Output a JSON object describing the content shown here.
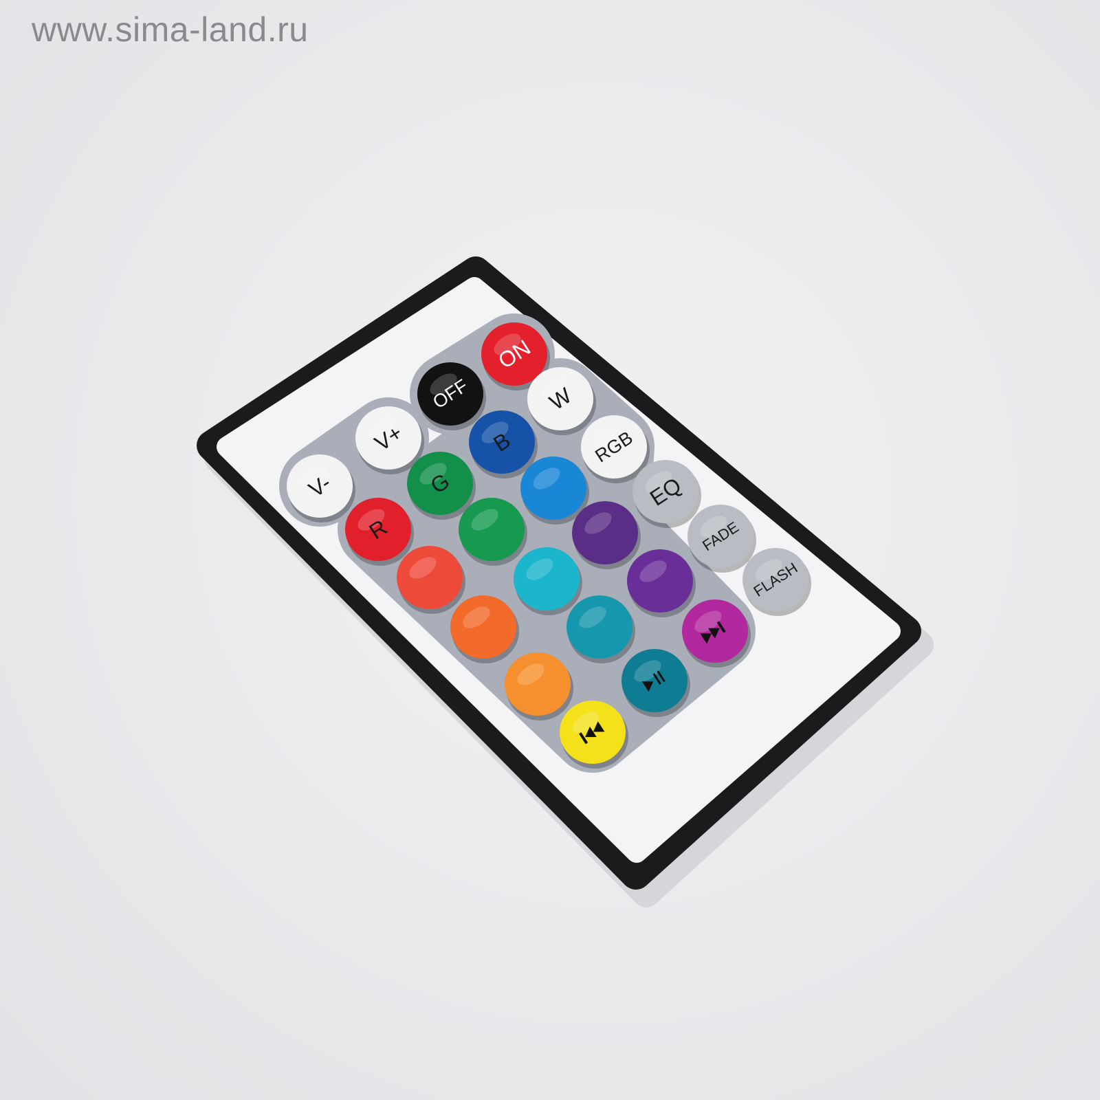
{
  "watermark": "www.sima-land.ru",
  "remote": {
    "body_color": "#1b1b1d",
    "face_color": "#f4f4f6",
    "panel_color": "#a9aeb8",
    "rows": [
      [
        {
          "label": "V-",
          "color": "#f3f3f3",
          "text": "#1a1a1a"
        },
        {
          "label": "V+",
          "color": "#f3f3f3",
          "text": "#1a1a1a"
        },
        {
          "label": "OFF",
          "color": "#121212",
          "text": "#ffffff"
        },
        {
          "label": "ON",
          "color": "#e3202b",
          "text": "#ffffff"
        }
      ],
      [
        {
          "label": "R",
          "color": "#e2202b",
          "text": "#1a1a1a"
        },
        {
          "label": "G",
          "color": "#12904a",
          "text": "#1a1a1a"
        },
        {
          "label": "B",
          "color": "#1552a8",
          "text": "#1a1a1a"
        },
        {
          "label": "W",
          "color": "#f3f3f3",
          "text": "#1a1a1a"
        }
      ],
      [
        {
          "label": "",
          "color": "#ee4a3a"
        },
        {
          "label": "",
          "color": "#179a50"
        },
        {
          "label": "",
          "color": "#1a86d6"
        },
        {
          "label": "RGB",
          "color": "#f3f3f3",
          "text": "#1a1a1a"
        }
      ],
      [
        {
          "label": "",
          "color": "#f26b2a"
        },
        {
          "label": "",
          "color": "#1bb5cc"
        },
        {
          "label": "",
          "color": "#5a2e86"
        },
        {
          "label": "EQ",
          "color": "#b9bcc3",
          "text": "#1a1a1a"
        }
      ],
      [
        {
          "label": "",
          "color": "#f6902e"
        },
        {
          "label": "",
          "color": "#1597ae"
        },
        {
          "label": "",
          "color": "#6a2e98"
        },
        {
          "label": "FADE",
          "color": "#b9bcc3",
          "text": "#1a1a1a"
        }
      ],
      [
        {
          "label": "",
          "icon": "previous-icon",
          "color": "#f5e11a"
        },
        {
          "label": "",
          "icon": "play-pause-icon",
          "color": "#0e7c93"
        },
        {
          "label": "",
          "icon": "next-icon",
          "color": "#b2289e"
        },
        {
          "label": "FLASH",
          "color": "#b9bcc3",
          "text": "#1a1a1a"
        }
      ]
    ]
  }
}
